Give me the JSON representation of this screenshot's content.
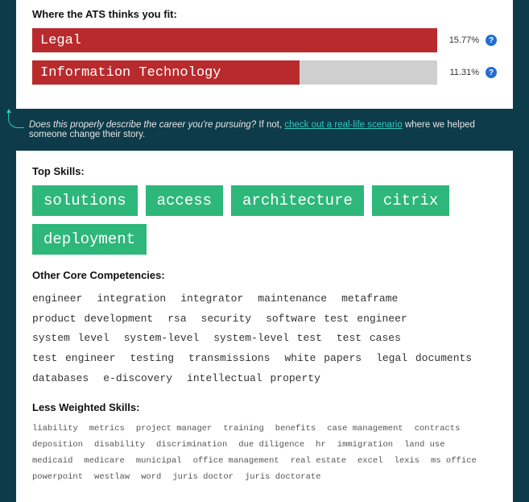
{
  "chart_data": {
    "type": "bar",
    "title": "Where the ATS thinks you fit:",
    "categories": [
      "Legal",
      "Information Technology"
    ],
    "values": [
      15.77,
      11.31
    ],
    "xlim": [
      0,
      15.77
    ]
  },
  "ats": {
    "heading": "Where the ATS thinks you fit:",
    "bars": [
      {
        "label": "Legal",
        "pct_text": "15.77%",
        "width": 100
      },
      {
        "label": "Information Technology",
        "pct_text": "11.31%",
        "width": 66
      }
    ]
  },
  "callout": {
    "q": "Does this properly describe the career you're pursuing?",
    "mid": " If not, ",
    "link": "check out a real-life scenario",
    "tail": " where we helped someone change their story."
  },
  "skills": {
    "top_heading": "Top Skills:",
    "top": [
      "solutions",
      "access",
      "architecture",
      "citrix",
      "deployment"
    ],
    "core_heading": "Other Core Competencies:",
    "core": [
      "engineer",
      "integration",
      "integrator",
      "maintenance",
      "metaframe",
      "product development",
      "rsa",
      "security",
      "software test engineer",
      "system level",
      "system-level",
      "system-level test",
      "test cases",
      "test engineer",
      "testing",
      "transmissions",
      "white papers",
      "legal documents",
      "databases",
      "e-discovery",
      "intellectual property"
    ],
    "less_heading": "Less Weighted Skills:",
    "less": [
      "liability",
      "metrics",
      "project manager",
      "training",
      "benefits",
      "case management",
      "contracts",
      "deposition",
      "disability",
      "discrimination",
      "due diligence",
      "hr",
      "immigration",
      "land use",
      "medicaid",
      "medicare",
      "municipal",
      "office management",
      "real estate",
      "excel",
      "lexis",
      "ms office",
      "powerpoint",
      "westlaw",
      "word",
      "juris doctor",
      "juris doctorate"
    ]
  },
  "glyph": {
    "question": "?"
  }
}
